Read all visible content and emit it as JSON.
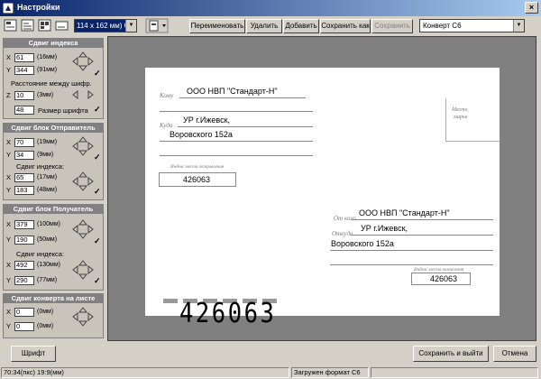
{
  "window": {
    "title": "Настройки",
    "close": "×"
  },
  "toolbar": {
    "size_value": "114 x 162 мм) С6",
    "rename": "Переименовать",
    "delete": "Удалить",
    "add": "Добавить",
    "save_as": "Сохранить как",
    "save": "Сохранить",
    "format_value": "Конверт С6"
  },
  "index_shift": {
    "header": "Сдвиг индекса",
    "x_value": "61",
    "x_unit": "(16мм)",
    "y_value": "344",
    "y_unit": "(91мм)",
    "spacing_label": "Расстояние между шифр.",
    "z_value": "10",
    "z_unit": "(3мм)",
    "font_size_value": "48",
    "font_size_label": "Размер шрифта"
  },
  "sender_block": {
    "header": "Сдвиг блок Отправитель",
    "x_value": "70",
    "x_unit": "(19мм)",
    "y_value": "34",
    "y_unit": "(9мм)",
    "index_label": "Сдвиг индекса:",
    "ix_value": "65",
    "ix_unit": "(17мм)",
    "iy_value": "183",
    "iy_unit": "(48мм)"
  },
  "recipient_block": {
    "header": "Сдвиг блок Получатель",
    "x_value": "379",
    "x_unit": "(100мм)",
    "y_value": "190",
    "y_unit": "(50мм)",
    "index_label": "Сдвиг индекса:",
    "ix_value": "492",
    "ix_unit": "(130мм)",
    "iy_value": "290",
    "iy_unit": "(77мм)"
  },
  "sheet_shift": {
    "header": "Сдвиг конверта на листе",
    "x_value": "0",
    "x_unit": "(0мм)",
    "y_value": "0",
    "y_unit": "(0мм)"
  },
  "axis": {
    "x": "X",
    "y": "Y",
    "z": "Z"
  },
  "envelope": {
    "to_label": "Кому",
    "to_value": "ООО НВП \"Стандарт-Н\"",
    "where_label": "Куда",
    "where_line1": "УР  г.Ижевск,",
    "where_line2": "Воровского  152а",
    "stamp_line1": "Место",
    "stamp_line2": "марки",
    "sender_index_caption": "Индекс места отправления",
    "sender_index": "426063",
    "from_label": "От кого",
    "from_value": "ООО НВП \"Стандарт-Н\"",
    "from_where_label": "Откуда",
    "from_where_line1": "УР  г.Ижевск,",
    "from_where_line2": "Воровского  152а",
    "dest_index_caption": "Индекс места назначения",
    "dest_index": "426063",
    "big_index": "426063"
  },
  "bottom": {
    "font_button": "Шрифт",
    "save_exit": "Сохранить и выйти",
    "cancel": "Отмена"
  },
  "status": {
    "coords": "70:34(пкс) 19:9(мм)",
    "message": "Загружен формат С6"
  }
}
